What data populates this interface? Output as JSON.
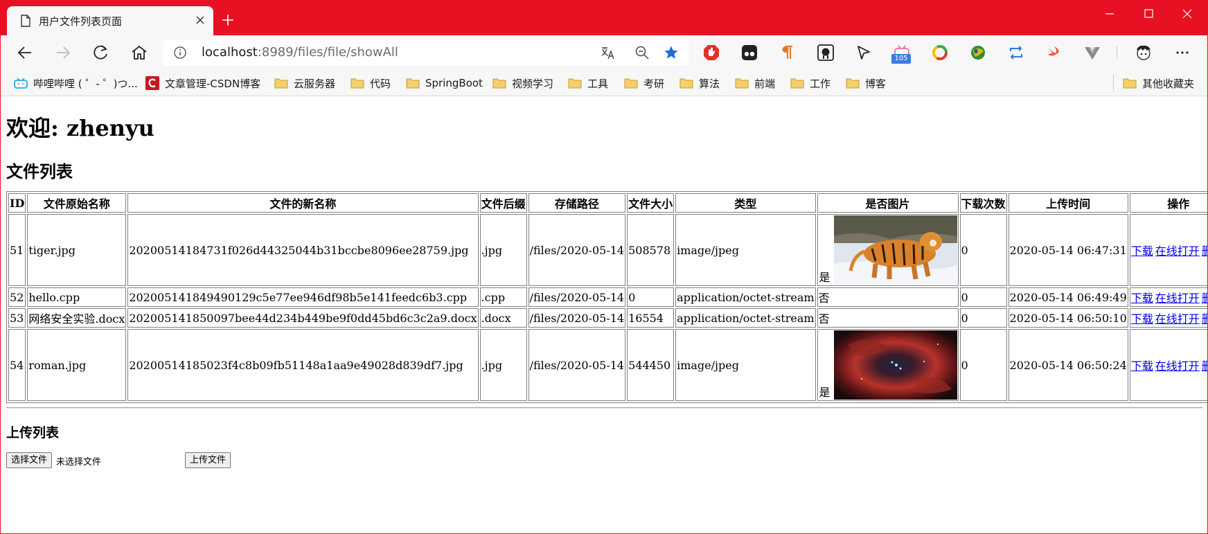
{
  "browser": {
    "tab_title": "用户文件列表页面",
    "url_host": "localhost",
    "url_path": ":8989/files/file/showAll",
    "extension_badge": "105"
  },
  "favorites": [
    {
      "label": "哔哩哔哩 ( ゜- ゜)つ...",
      "icon": "bilibili-icon"
    },
    {
      "label": "文章管理-CSDN博客",
      "icon": "csdn-icon"
    },
    {
      "label": "云服务器",
      "icon": "folder-icon"
    },
    {
      "label": "代码",
      "icon": "folder-icon"
    },
    {
      "label": "SpringBoot",
      "icon": "folder-icon"
    },
    {
      "label": "视频学习",
      "icon": "folder-icon"
    },
    {
      "label": "工具",
      "icon": "folder-icon"
    },
    {
      "label": "考研",
      "icon": "folder-icon"
    },
    {
      "label": "算法",
      "icon": "folder-icon"
    },
    {
      "label": "前端",
      "icon": "folder-icon"
    },
    {
      "label": "工作",
      "icon": "folder-icon"
    },
    {
      "label": "博客",
      "icon": "folder-icon"
    },
    {
      "label": "其他收藏夹",
      "icon": "folder-icon"
    }
  ],
  "page": {
    "welcome": "欢迎: zhenyu",
    "list_title": "文件列表",
    "upload_title": "上传列表",
    "choose_file_label": "选择文件",
    "no_file_text": "未选择文件",
    "upload_button_label": "上传文件"
  },
  "table": {
    "headers": [
      "ID",
      "文件原始名称",
      "文件的新名称",
      "文件后缀",
      "存储路径",
      "文件大小",
      "类型",
      "是否图片",
      "下载次数",
      "上传时间",
      "操作"
    ],
    "rows": [
      {
        "id": "51",
        "original": "tiger.jpg",
        "new_name": "20200514184731f026d44325044b31bccbe8096ee28759.jpg",
        "ext": ".jpg",
        "path": "/files/2020-05-14",
        "size": "508578",
        "type": "image/jpeg",
        "is_image": "是",
        "thumbnail": "tiger",
        "downloads": "0",
        "uploaded": "2020-05-14 06:47:31"
      },
      {
        "id": "52",
        "original": "hello.cpp",
        "new_name": "20200514184949​0129c5e77ee946df98b5e141feedc6b3.cpp",
        "ext": ".cpp",
        "path": "/files/2020-05-14",
        "size": "0",
        "type": "application/octet-stream",
        "is_image": "否",
        "thumbnail": "",
        "downloads": "0",
        "uploaded": "2020-05-14 06:49:49"
      },
      {
        "id": "53",
        "original": "网络安全实验.docx",
        "new_name": "20200514185009​7bee44d234b449be9f0dd45bd6c3c2a9.docx",
        "ext": ".docx",
        "path": "/files/2020-05-14",
        "size": "16554",
        "type": "application/octet-stream",
        "is_image": "否",
        "thumbnail": "",
        "downloads": "0",
        "uploaded": "2020-05-14 06:50:10"
      },
      {
        "id": "54",
        "original": "roman.jpg",
        "new_name": "20200514185023f4c8b09fb51148a1aa9e49028d839df7.jpg",
        "ext": ".jpg",
        "path": "/files/2020-05-14",
        "size": "544450",
        "type": "image/jpeg",
        "is_image": "是",
        "thumbnail": "nebula",
        "downloads": "0",
        "uploaded": "2020-05-14 06:50:24"
      }
    ],
    "actions": [
      "下载",
      "在线打开",
      "删除"
    ]
  },
  "colors": {
    "title_bar": "#e81123",
    "link": "#0000ee"
  }
}
